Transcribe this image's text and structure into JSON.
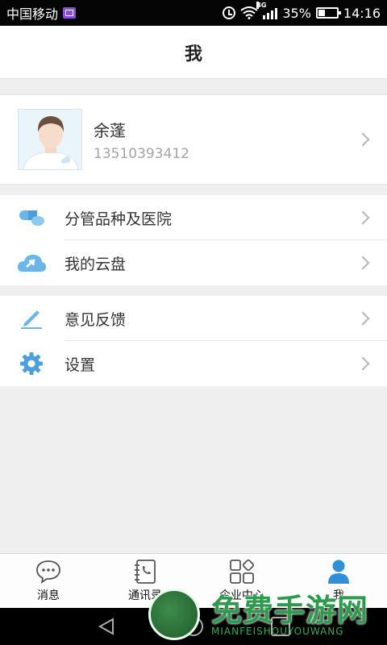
{
  "status_bar": {
    "carrier": "中国移动",
    "network": "4G",
    "battery": "35%",
    "battery_level": 0.35,
    "time": "14:16"
  },
  "header": {
    "title": "我"
  },
  "profile": {
    "name": "余蓬",
    "phone": "13510393412"
  },
  "menu_group_1": [
    {
      "label": "分管品种及医院",
      "icon": "pills-icon"
    },
    {
      "label": "我的云盘",
      "icon": "cloud-icon"
    }
  ],
  "menu_group_2": [
    {
      "label": "意见反馈",
      "icon": "pencil-icon"
    },
    {
      "label": "设置",
      "icon": "gear-icon"
    }
  ],
  "tabs": [
    {
      "label": "消息",
      "icon": "chat-bubble-icon",
      "active": false
    },
    {
      "label": "通讯录",
      "icon": "contacts-book-icon",
      "active": false
    },
    {
      "label": "企业中心",
      "icon": "apps-grid-icon",
      "active": false
    },
    {
      "label": "我",
      "icon": "person-icon",
      "active": true
    }
  ],
  "watermark": {
    "text": "免费手游网",
    "subtext": "MIANFEISHOUYOUWANG"
  },
  "colors": {
    "accent": "#2f8fd8",
    "icon_light_blue": "#6ab6e8",
    "background": "#efefef",
    "watermark_green": "#2e9b4c"
  }
}
